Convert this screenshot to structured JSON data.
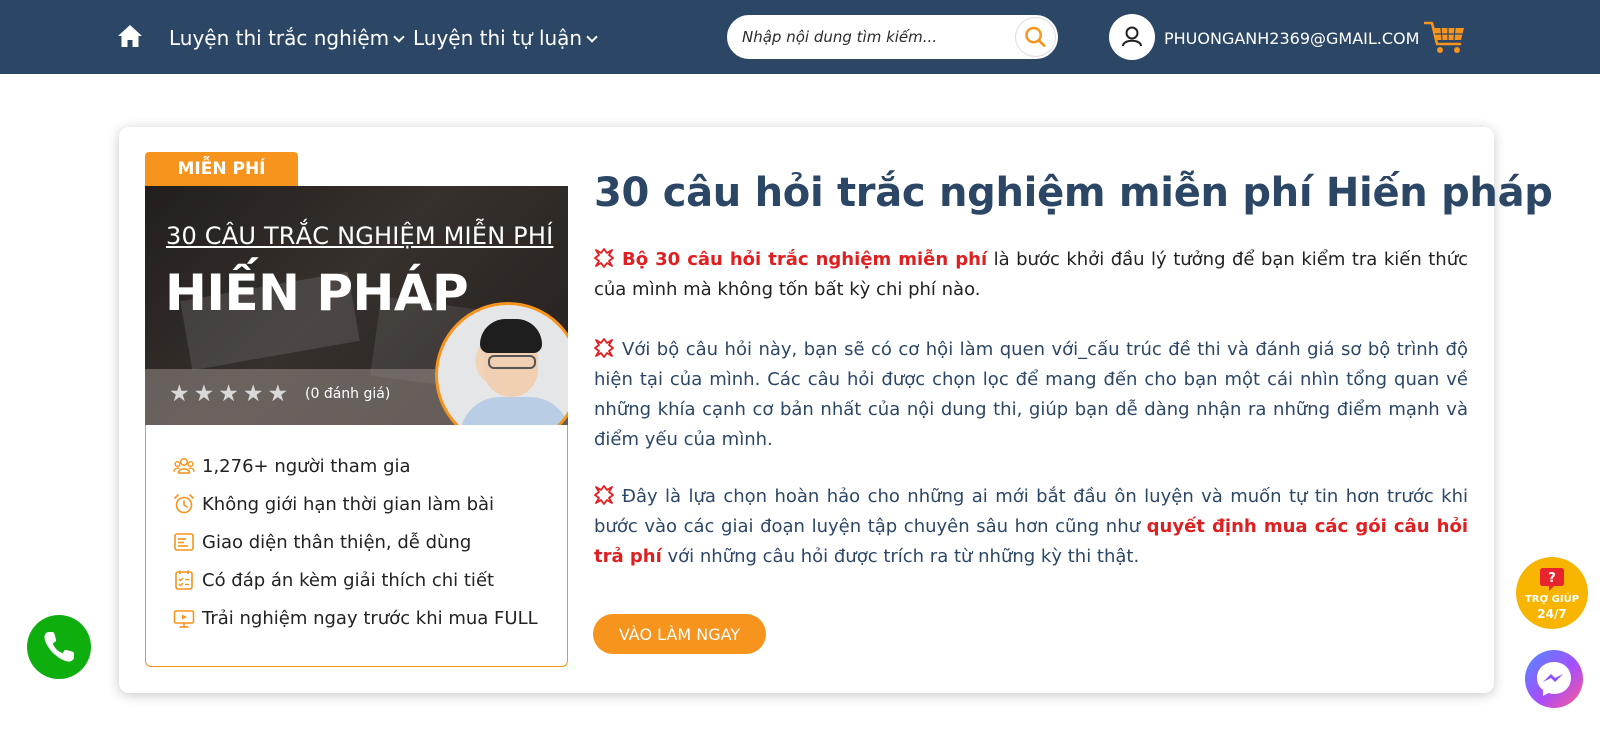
{
  "header": {
    "nav": [
      {
        "label": "Luyện thi trắc nghiệm"
      },
      {
        "label": "Luyện thi tự luận"
      }
    ],
    "search": {
      "placeholder": "Nhập nội dung tìm kiếm..."
    },
    "user": {
      "email": "PHUONGANH2369@GMAIL.COM"
    },
    "icons": {
      "home": "home-icon",
      "search": "search-icon",
      "user": "user-icon",
      "cart": "cart-icon"
    }
  },
  "course": {
    "badge": "MIỄN PHÍ",
    "thumbnail": {
      "subtitle": "30 CÂU TRẮC NGHIỆM MIỄN PHÍ",
      "title": "HIẾN PHÁP",
      "rating_text": "(0 đánh giá)",
      "rating_value": 0
    },
    "features": [
      {
        "icon": "users-icon",
        "label": "1,276+ người tham gia"
      },
      {
        "icon": "alarm-clock-icon",
        "label": "Không giới hạn thời gian làm bài"
      },
      {
        "icon": "interface-icon",
        "label": "Giao diện thân thiện, dễ dùng"
      },
      {
        "icon": "checklist-icon",
        "label": "Có đáp án kèm giải thích chi tiết"
      },
      {
        "icon": "screen-play-icon",
        "label": "Trải nghiệm ngay trước khi mua FULL"
      }
    ],
    "title": "30 câu hỏi trắc nghiệm miễn phí Hiến pháp",
    "paragraphs": {
      "p1_highlight": "Bộ 30 câu hỏi trắc nghiệm miễn phí",
      "p1_rest": " là bước khởi đầu lý tưởng để bạn kiểm tra kiến thức của mình mà không tốn bất kỳ chi phí nào.",
      "p2": "Với bộ câu hỏi này, bạn sẽ có cơ hội làm quen với_cấu trúc đề thi và đánh giá sơ bộ trình độ hiện tại của mình. Các câu hỏi được chọn lọc để mang đến cho bạn một cái nhìn tổng quan về những khía cạnh cơ bản nhất của nội dung thi, giúp bạn dễ dàng nhận ra những điểm mạnh và điểm yếu của mình.",
      "p3_start": "Đây là lựa chọn hoàn hảo cho những ai mới bắt đầu ôn luyện và muốn tự tin hơn trước khi bước vào các giai đoạn luyện tập chuyên sâu hơn cũng như ",
      "p3_highlight": "quyết định mua các gói câu hỏi trả phí",
      "p3_end": " với những câu hỏi được trích ra từ những kỳ thi thật."
    },
    "cta_label": "VÀO LÀM NGAY"
  },
  "floating": {
    "help_line1": "TRỢ GIÚP",
    "help_line2": "24/7"
  },
  "colors": {
    "header_bg": "#2c4766",
    "accent_orange": "#f7941d",
    "highlight_red": "#e02020",
    "title_navy": "#2c4766",
    "call_green": "#0fae0f"
  }
}
